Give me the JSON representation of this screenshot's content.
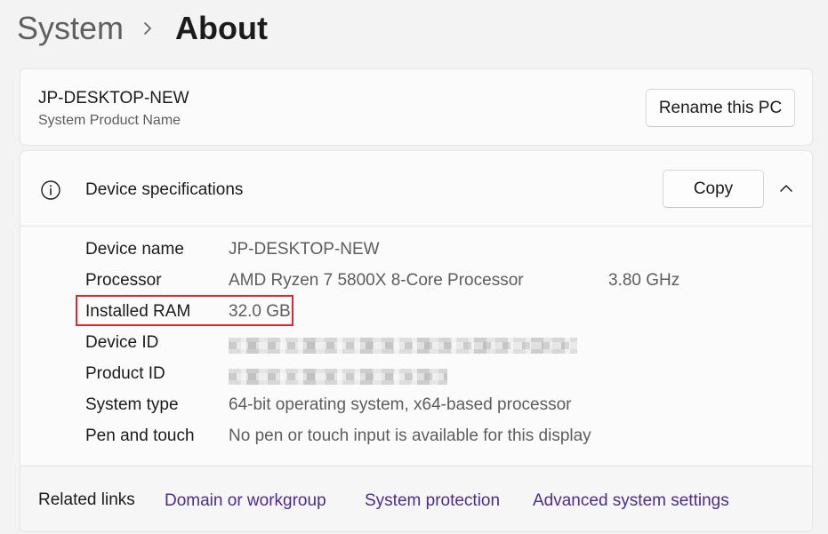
{
  "breadcrumb": {
    "parent": "System",
    "current": "About"
  },
  "pc_card": {
    "name": "JP-DESKTOP-NEW",
    "subtitle": "System Product Name",
    "rename_button": "Rename this PC"
  },
  "device_specs": {
    "title": "Device specifications",
    "copy_button": "Copy",
    "expanded": true,
    "rows": [
      {
        "label": "Device name",
        "value": "JP-DESKTOP-NEW",
        "extra": ""
      },
      {
        "label": "Processor",
        "value": "AMD Ryzen 7 5800X 8-Core Processor",
        "extra": "3.80 GHz"
      },
      {
        "label": "Installed RAM",
        "value": "32.0 GB",
        "extra": ""
      },
      {
        "label": "Device ID",
        "value": "",
        "extra": ""
      },
      {
        "label": "Product ID",
        "value": "",
        "extra": ""
      },
      {
        "label": "System type",
        "value": "64-bit operating system, x64-based processor",
        "extra": ""
      },
      {
        "label": "Pen and touch",
        "value": "No pen or touch input is available for this display",
        "extra": ""
      }
    ]
  },
  "related": {
    "label": "Related links",
    "links": [
      "Domain or workgroup",
      "System protection",
      "Advanced system settings"
    ]
  },
  "icons": {
    "breadcrumb_separator": "chevron-right-icon",
    "specs": "info-icon",
    "collapse": "chevron-up-icon"
  },
  "colors": {
    "link": "#4f2b8a",
    "highlight": "#e0282e",
    "background": "#f3f3f3",
    "card": "#fbfbfb"
  }
}
